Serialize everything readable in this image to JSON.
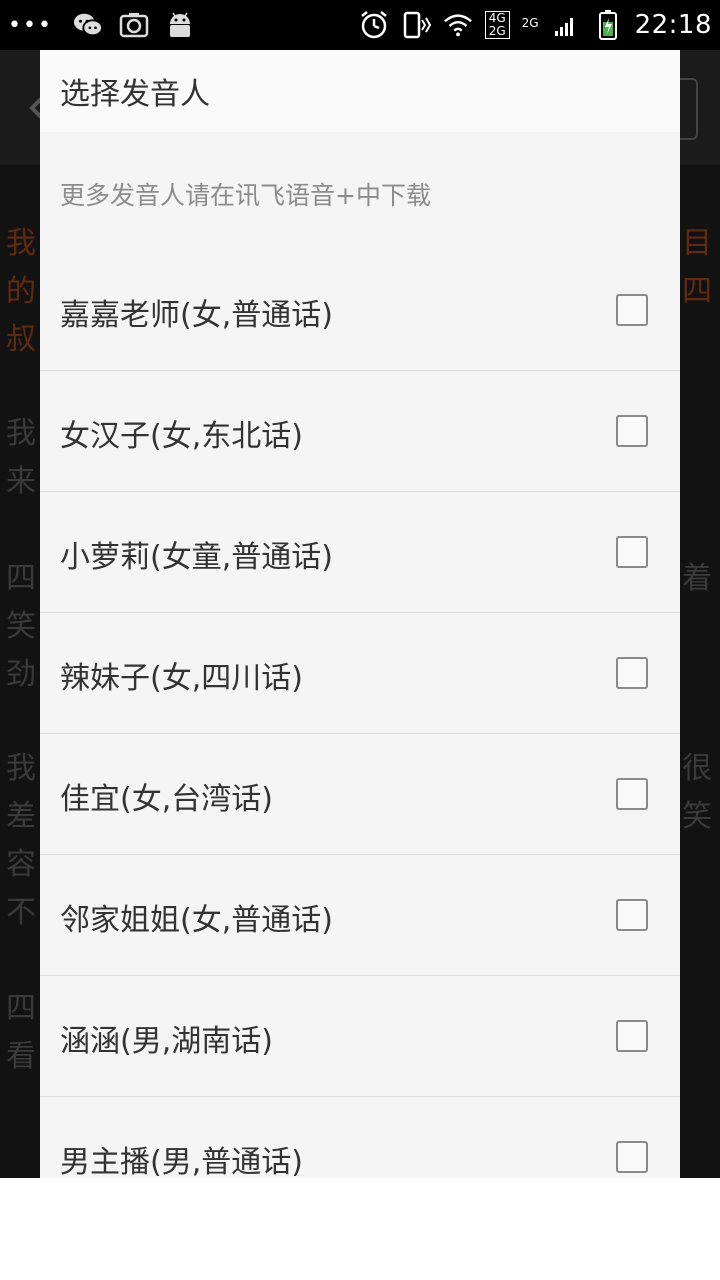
{
  "status_bar": {
    "overflow": "•••",
    "network_top": "4G",
    "network_bottom": "2G",
    "network_2g": "2G",
    "time": "22:18"
  },
  "background": {
    "lines": [
      {
        "text": "我",
        "accent": true
      },
      {
        "text": "的",
        "accent": true
      },
      {
        "text": "叔",
        "accent": true
      },
      {
        "text": "目",
        "accent": true
      },
      {
        "text": "四",
        "accent": true
      },
      {
        "text": "我",
        "accent": false
      },
      {
        "text": "来",
        "accent": false
      },
      {
        "text": "四",
        "accent": false
      },
      {
        "text": "笑",
        "accent": false
      },
      {
        "text": "劲",
        "accent": false
      },
      {
        "text": "我",
        "accent": false
      },
      {
        "text": "差",
        "accent": false
      },
      {
        "text": "容",
        "accent": false
      },
      {
        "text": "不",
        "accent": false
      },
      {
        "text": "四",
        "accent": false
      },
      {
        "text": "看",
        "accent": false
      },
      {
        "text": "着",
        "accent": false
      },
      {
        "text": "很",
        "accent": false
      },
      {
        "text": "笑",
        "accent": false
      }
    ]
  },
  "dialog": {
    "title": "选择发音人",
    "hint": "更多发音人请在讯飞语音+中下载",
    "items": [
      {
        "label": "嘉嘉老师(女,普通话)",
        "checked": false
      },
      {
        "label": "女汉子(女,东北话)",
        "checked": false
      },
      {
        "label": "小萝莉(女童,普通话)",
        "checked": false
      },
      {
        "label": "辣妹子(女,四川话)",
        "checked": false
      },
      {
        "label": "佳宜(女,台湾话)",
        "checked": false
      },
      {
        "label": "邻家姐姐(女,普通话)",
        "checked": false
      },
      {
        "label": "涵涵(男,湖南话)",
        "checked": false
      },
      {
        "label": "男主播(男,普通话)",
        "checked": false
      }
    ]
  }
}
